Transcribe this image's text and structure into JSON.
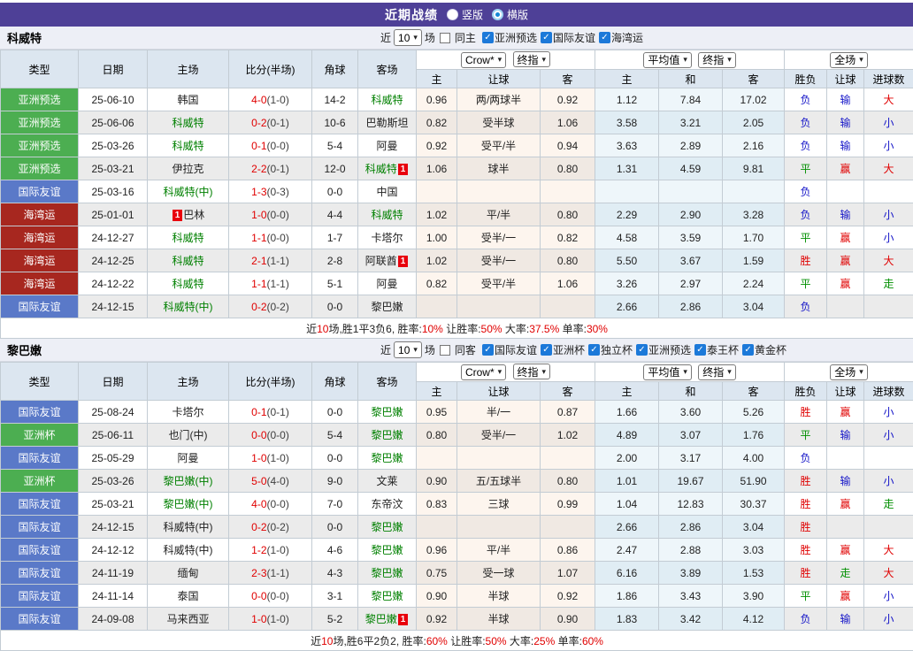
{
  "title_bar": {
    "title": "近期战绩",
    "vertical_label": "竖版",
    "horizontal_label": "横版"
  },
  "filter_labels": {
    "near": "近",
    "matches": "场"
  },
  "header": {
    "type": "类型",
    "date": "日期",
    "home": "主场",
    "score": "比分(半场)",
    "corner": "角球",
    "away": "客场",
    "odds_home": "主",
    "odds_handicap": "让球",
    "odds_away": "客",
    "avg_home": "主",
    "avg_draw": "和",
    "avg_away": "客",
    "win_loss": "胜负",
    "handicap_result": "让球",
    "goals": "进球数",
    "select_crow": "Crow*",
    "select_final": "终指",
    "select_avg": "平均值",
    "select_final2": "终指",
    "select_full": "全场"
  },
  "colors": {
    "accent_purple": "#4e4097",
    "type_green": "#4cae51",
    "type_blue": "#5a79c8",
    "type_darkred": "#a7271f",
    "focus_team_green": "#008000",
    "score_red": "#e00000",
    "result_red": "#e00000",
    "result_green": "#008f00",
    "result_blue": "#1515c8"
  },
  "sections": [
    {
      "team": "科威特",
      "filter": {
        "count": "10",
        "same_label": "同主",
        "competitions": [
          "亚洲预选",
          "国际友谊",
          "海湾运"
        ]
      },
      "rows": [
        {
          "type": "亚洲预选",
          "type_color": "green",
          "date": "25-06-10",
          "home": "韩国",
          "home_green": false,
          "home_badge": "",
          "score": "4-0",
          "half": "(1-0)",
          "corner": "14-2",
          "away": "科威特",
          "away_green": true,
          "away_badge": "",
          "o1": "0.96",
          "hcap": "两/两球半",
          "o2": "0.92",
          "a1": "1.12",
          "a2": "7.84",
          "a3": "17.02",
          "wl": "负",
          "wl_c": "blue",
          "hr": "输",
          "hr_c": "blue",
          "gr": "大",
          "gr_c": "red"
        },
        {
          "type": "亚洲预选",
          "type_color": "green",
          "date": "25-06-06",
          "home": "科威特",
          "home_green": true,
          "home_badge": "",
          "score": "0-2",
          "half": "(0-1)",
          "corner": "10-6",
          "away": "巴勒斯坦",
          "away_green": false,
          "away_badge": "",
          "o1": "0.82",
          "hcap": "受半球",
          "o2": "1.06",
          "a1": "3.58",
          "a2": "3.21",
          "a3": "2.05",
          "wl": "负",
          "wl_c": "blue",
          "hr": "输",
          "hr_c": "blue",
          "gr": "小",
          "gr_c": "blue"
        },
        {
          "type": "亚洲预选",
          "type_color": "green",
          "date": "25-03-26",
          "home": "科威特",
          "home_green": true,
          "home_badge": "",
          "score": "0-1",
          "half": "(0-0)",
          "corner": "5-4",
          "away": "阿曼",
          "away_green": false,
          "away_badge": "",
          "o1": "0.92",
          "hcap": "受平/半",
          "o2": "0.94",
          "a1": "3.63",
          "a2": "2.89",
          "a3": "2.16",
          "wl": "负",
          "wl_c": "blue",
          "hr": "输",
          "hr_c": "blue",
          "gr": "小",
          "gr_c": "blue"
        },
        {
          "type": "亚洲预选",
          "type_color": "green",
          "date": "25-03-21",
          "home": "伊拉克",
          "home_green": false,
          "home_badge": "",
          "score": "2-2",
          "half": "(0-1)",
          "corner": "12-0",
          "away": "科威特",
          "away_green": true,
          "away_badge": "1",
          "o1": "1.06",
          "hcap": "球半",
          "o2": "0.80",
          "a1": "1.31",
          "a2": "4.59",
          "a3": "9.81",
          "wl": "平",
          "wl_c": "green",
          "hr": "赢",
          "hr_c": "red",
          "gr": "大",
          "gr_c": "red"
        },
        {
          "type": "国际友谊",
          "type_color": "blue",
          "date": "25-03-16",
          "home": "科威特(中)",
          "home_green": true,
          "home_badge": "",
          "score": "1-3",
          "half": "(0-3)",
          "corner": "0-0",
          "away": "中国",
          "away_green": false,
          "away_badge": "",
          "o1": "",
          "hcap": "",
          "o2": "",
          "a1": "",
          "a2": "",
          "a3": "",
          "wl": "负",
          "wl_c": "blue",
          "hr": "",
          "hr_c": "",
          "gr": "",
          "gr_c": ""
        },
        {
          "type": "海湾运",
          "type_color": "darkred",
          "date": "25-01-01",
          "home": "巴林",
          "home_green": false,
          "home_badge": "1",
          "score": "1-0",
          "half": "(0-0)",
          "corner": "4-4",
          "away": "科威特",
          "away_green": true,
          "away_badge": "",
          "o1": "1.02",
          "hcap": "平/半",
          "o2": "0.80",
          "a1": "2.29",
          "a2": "2.90",
          "a3": "3.28",
          "wl": "负",
          "wl_c": "blue",
          "hr": "输",
          "hr_c": "blue",
          "gr": "小",
          "gr_c": "blue"
        },
        {
          "type": "海湾运",
          "type_color": "darkred",
          "date": "24-12-27",
          "home": "科威特",
          "home_green": true,
          "home_badge": "",
          "score": "1-1",
          "half": "(0-0)",
          "corner": "1-7",
          "away": "卡塔尔",
          "away_green": false,
          "away_badge": "",
          "o1": "1.00",
          "hcap": "受半/一",
          "o2": "0.82",
          "a1": "4.58",
          "a2": "3.59",
          "a3": "1.70",
          "wl": "平",
          "wl_c": "green",
          "hr": "赢",
          "hr_c": "red",
          "gr": "小",
          "gr_c": "blue"
        },
        {
          "type": "海湾运",
          "type_color": "darkred",
          "date": "24-12-25",
          "home": "科威特",
          "home_green": true,
          "home_badge": "",
          "score": "2-1",
          "half": "(1-1)",
          "corner": "2-8",
          "away": "阿联酋",
          "away_green": false,
          "away_badge": "1",
          "o1": "1.02",
          "hcap": "受半/一",
          "o2": "0.80",
          "a1": "5.50",
          "a2": "3.67",
          "a3": "1.59",
          "wl": "胜",
          "wl_c": "red",
          "hr": "赢",
          "hr_c": "red",
          "gr": "大",
          "gr_c": "red"
        },
        {
          "type": "海湾运",
          "type_color": "darkred",
          "date": "24-12-22",
          "home": "科威特",
          "home_green": true,
          "home_badge": "",
          "score": "1-1",
          "half": "(1-1)",
          "corner": "5-1",
          "away": "阿曼",
          "away_green": false,
          "away_badge": "",
          "o1": "0.82",
          "hcap": "受平/半",
          "o2": "1.06",
          "a1": "3.26",
          "a2": "2.97",
          "a3": "2.24",
          "wl": "平",
          "wl_c": "green",
          "hr": "赢",
          "hr_c": "red",
          "gr": "走",
          "gr_c": "green"
        },
        {
          "type": "国际友谊",
          "type_color": "blue",
          "date": "24-12-15",
          "home": "科威特(中)",
          "home_green": true,
          "home_badge": "",
          "score": "0-2",
          "half": "(0-2)",
          "corner": "0-0",
          "away": "黎巴嫩",
          "away_green": false,
          "away_badge": "",
          "o1": "",
          "hcap": "",
          "o2": "",
          "a1": "2.66",
          "a2": "2.86",
          "a3": "3.04",
          "wl": "负",
          "wl_c": "blue",
          "hr": "",
          "hr_c": "",
          "gr": "",
          "gr_c": ""
        }
      ],
      "summary": [
        {
          "t": "近",
          "red": false
        },
        {
          "t": "10",
          "red": true
        },
        {
          "t": "场,胜1平3负6, 胜率:",
          "red": false
        },
        {
          "t": "10%",
          "red": true
        },
        {
          "t": " 让胜率:",
          "red": false
        },
        {
          "t": "50%",
          "red": true
        },
        {
          "t": " 大率:",
          "red": false
        },
        {
          "t": "37.5%",
          "red": true
        },
        {
          "t": " 单率:",
          "red": false
        },
        {
          "t": "30%",
          "red": true
        }
      ]
    },
    {
      "team": "黎巴嫩",
      "filter": {
        "count": "10",
        "same_label": "同客",
        "competitions": [
          "国际友谊",
          "亚洲杯",
          "独立杯",
          "亚洲预选",
          "泰王杯",
          "黄金杯"
        ]
      },
      "rows": [
        {
          "type": "国际友谊",
          "type_color": "blue",
          "date": "25-08-24",
          "home": "卡塔尔",
          "home_green": false,
          "home_badge": "",
          "score": "0-1",
          "half": "(0-1)",
          "corner": "0-0",
          "away": "黎巴嫩",
          "away_green": true,
          "away_badge": "",
          "o1": "0.95",
          "hcap": "半/一",
          "o2": "0.87",
          "a1": "1.66",
          "a2": "3.60",
          "a3": "5.26",
          "wl": "胜",
          "wl_c": "red",
          "hr": "赢",
          "hr_c": "red",
          "gr": "小",
          "gr_c": "blue"
        },
        {
          "type": "亚洲杯",
          "type_color": "green",
          "date": "25-06-11",
          "home": "也门(中)",
          "home_green": false,
          "home_badge": "",
          "score": "0-0",
          "half": "(0-0)",
          "corner": "5-4",
          "away": "黎巴嫩",
          "away_green": true,
          "away_badge": "",
          "o1": "0.80",
          "hcap": "受半/一",
          "o2": "1.02",
          "a1": "4.89",
          "a2": "3.07",
          "a3": "1.76",
          "wl": "平",
          "wl_c": "green",
          "hr": "输",
          "hr_c": "blue",
          "gr": "小",
          "gr_c": "blue"
        },
        {
          "type": "国际友谊",
          "type_color": "blue",
          "date": "25-05-29",
          "home": "阿曼",
          "home_green": false,
          "home_badge": "",
          "score": "1-0",
          "half": "(1-0)",
          "corner": "0-0",
          "away": "黎巴嫩",
          "away_green": true,
          "away_badge": "",
          "o1": "",
          "hcap": "",
          "o2": "",
          "a1": "2.00",
          "a2": "3.17",
          "a3": "4.00",
          "wl": "负",
          "wl_c": "blue",
          "hr": "",
          "hr_c": "",
          "gr": "",
          "gr_c": ""
        },
        {
          "type": "亚洲杯",
          "type_color": "green",
          "date": "25-03-26",
          "home": "黎巴嫩(中)",
          "home_green": true,
          "home_badge": "",
          "score": "5-0",
          "half": "(4-0)",
          "corner": "9-0",
          "away": "文莱",
          "away_green": false,
          "away_badge": "",
          "o1": "0.90",
          "hcap": "五/五球半",
          "o2": "0.80",
          "a1": "1.01",
          "a2": "19.67",
          "a3": "51.90",
          "wl": "胜",
          "wl_c": "red",
          "hr": "输",
          "hr_c": "blue",
          "gr": "小",
          "gr_c": "blue"
        },
        {
          "type": "国际友谊",
          "type_color": "blue",
          "date": "25-03-21",
          "home": "黎巴嫩(中)",
          "home_green": true,
          "home_badge": "",
          "score": "4-0",
          "half": "(0-0)",
          "corner": "7-0",
          "away": "东帝汶",
          "away_green": false,
          "away_badge": "",
          "o1": "0.83",
          "hcap": "三球",
          "o2": "0.99",
          "a1": "1.04",
          "a2": "12.83",
          "a3": "30.37",
          "wl": "胜",
          "wl_c": "red",
          "hr": "赢",
          "hr_c": "red",
          "gr": "走",
          "gr_c": "green"
        },
        {
          "type": "国际友谊",
          "type_color": "blue",
          "date": "24-12-15",
          "home": "科威特(中)",
          "home_green": false,
          "home_badge": "",
          "score": "0-2",
          "half": "(0-2)",
          "corner": "0-0",
          "away": "黎巴嫩",
          "away_green": true,
          "away_badge": "",
          "o1": "",
          "hcap": "",
          "o2": "",
          "a1": "2.66",
          "a2": "2.86",
          "a3": "3.04",
          "wl": "胜",
          "wl_c": "red",
          "hr": "",
          "hr_c": "",
          "gr": "",
          "gr_c": ""
        },
        {
          "type": "国际友谊",
          "type_color": "blue",
          "date": "24-12-12",
          "home": "科威特(中)",
          "home_green": false,
          "home_badge": "",
          "score": "1-2",
          "half": "(1-0)",
          "corner": "4-6",
          "away": "黎巴嫩",
          "away_green": true,
          "away_badge": "",
          "o1": "0.96",
          "hcap": "平/半",
          "o2": "0.86",
          "a1": "2.47",
          "a2": "2.88",
          "a3": "3.03",
          "wl": "胜",
          "wl_c": "red",
          "hr": "赢",
          "hr_c": "red",
          "gr": "大",
          "gr_c": "red"
        },
        {
          "type": "国际友谊",
          "type_color": "blue",
          "date": "24-11-19",
          "home": "缅甸",
          "home_green": false,
          "home_badge": "",
          "score": "2-3",
          "half": "(1-1)",
          "corner": "4-3",
          "away": "黎巴嫩",
          "away_green": true,
          "away_badge": "",
          "o1": "0.75",
          "hcap": "受一球",
          "o2": "1.07",
          "a1": "6.16",
          "a2": "3.89",
          "a3": "1.53",
          "wl": "胜",
          "wl_c": "red",
          "hr": "走",
          "hr_c": "green",
          "gr": "大",
          "gr_c": "red"
        },
        {
          "type": "国际友谊",
          "type_color": "blue",
          "date": "24-11-14",
          "home": "泰国",
          "home_green": false,
          "home_badge": "",
          "score": "0-0",
          "half": "(0-0)",
          "corner": "3-1",
          "away": "黎巴嫩",
          "away_green": true,
          "away_badge": "",
          "o1": "0.90",
          "hcap": "半球",
          "o2": "0.92",
          "a1": "1.86",
          "a2": "3.43",
          "a3": "3.90",
          "wl": "平",
          "wl_c": "green",
          "hr": "赢",
          "hr_c": "red",
          "gr": "小",
          "gr_c": "blue"
        },
        {
          "type": "国际友谊",
          "type_color": "blue",
          "date": "24-09-08",
          "home": "马来西亚",
          "home_green": false,
          "home_badge": "",
          "score": "1-0",
          "half": "(1-0)",
          "corner": "5-2",
          "away": "黎巴嫩",
          "away_green": true,
          "away_badge": "1",
          "o1": "0.92",
          "hcap": "半球",
          "o2": "0.90",
          "a1": "1.83",
          "a2": "3.42",
          "a3": "4.12",
          "wl": "负",
          "wl_c": "blue",
          "hr": "输",
          "hr_c": "blue",
          "gr": "小",
          "gr_c": "blue"
        }
      ],
      "summary": [
        {
          "t": "近",
          "red": false
        },
        {
          "t": "10",
          "red": true
        },
        {
          "t": "场,胜6平2负2, 胜率:",
          "red": false
        },
        {
          "t": "60%",
          "red": true
        },
        {
          "t": " 让胜率:",
          "red": false
        },
        {
          "t": "50%",
          "red": true
        },
        {
          "t": " 大率:",
          "red": false
        },
        {
          "t": "25%",
          "red": true
        },
        {
          "t": " 单率:",
          "red": false
        },
        {
          "t": "60%",
          "red": true
        }
      ]
    }
  ]
}
